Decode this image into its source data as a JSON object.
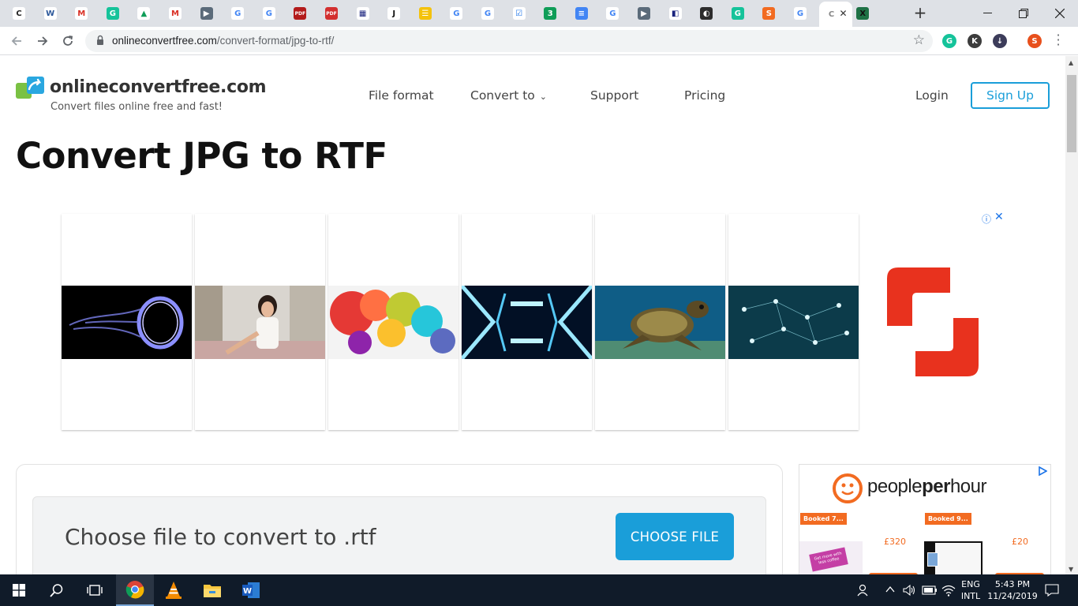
{
  "browser": {
    "tabs": [
      {
        "glyph": "C",
        "color": "#ffffff",
        "fg": "#222",
        "label": "C"
      },
      {
        "glyph": "W",
        "color": "#ffffff",
        "fg": "#2b579a",
        "label": "W"
      },
      {
        "glyph": "M",
        "color": "#ffffff",
        "fg": "#d93025",
        "label": "M"
      },
      {
        "glyph": "G",
        "color": "#15c39a",
        "fg": "#fff",
        "label": "G"
      },
      {
        "glyph": "▲",
        "color": "#ffffff",
        "fg": "#0f9d58",
        "label": "Drive"
      },
      {
        "glyph": "M",
        "color": "#ffffff",
        "fg": "#d93025",
        "label": "M"
      },
      {
        "glyph": "▶",
        "color": "#5b6b7a",
        "fg": "#fff",
        "label": "▶"
      },
      {
        "glyph": "G",
        "color": "#ffffff",
        "fg": "#4285f4",
        "label": "G"
      },
      {
        "glyph": "G",
        "color": "#ffffff",
        "fg": "#4285f4",
        "label": "G"
      },
      {
        "glyph": "PDF",
        "color": "#b31b1b",
        "fg": "#fff",
        "label": "PDF"
      },
      {
        "glyph": "PDF",
        "color": "#d32f2f",
        "fg": "#fff",
        "label": "PDF"
      },
      {
        "glyph": "▦",
        "color": "#ffffff",
        "fg": "#1a237e",
        "label": "▦"
      },
      {
        "glyph": "J",
        "color": "#ffffff",
        "fg": "#111",
        "label": "J"
      },
      {
        "glyph": "☰",
        "color": "#f4c20d",
        "fg": "#fff",
        "label": "☰"
      },
      {
        "glyph": "G",
        "color": "#ffffff",
        "fg": "#4285f4",
        "label": "G"
      },
      {
        "glyph": "G",
        "color": "#ffffff",
        "fg": "#4285f4",
        "label": "G"
      },
      {
        "glyph": "☑",
        "color": "#ffffff",
        "fg": "#1a73e8",
        "label": "☑"
      },
      {
        "glyph": "3",
        "color": "#0f9d58",
        "fg": "#fff",
        "label": "3"
      },
      {
        "glyph": "≡",
        "color": "#4285f4",
        "fg": "#fff",
        "label": "Docs"
      },
      {
        "glyph": "G",
        "color": "#ffffff",
        "fg": "#4285f4",
        "label": "G"
      },
      {
        "glyph": "▶",
        "color": "#5b6b7a",
        "fg": "#fff",
        "label": "▶"
      },
      {
        "glyph": "◧",
        "color": "#ffffff",
        "fg": "#1a237e",
        "label": "◧"
      },
      {
        "glyph": "◐",
        "color": "#2c2c2c",
        "fg": "#fff",
        "label": "◐"
      },
      {
        "glyph": "G",
        "color": "#15c39a",
        "fg": "#fff",
        "label": "G"
      },
      {
        "glyph": "S",
        "color": "#f26b21",
        "fg": "#fff",
        "label": "S"
      },
      {
        "glyph": "G",
        "color": "#ffffff",
        "fg": "#4285f4",
        "label": "G"
      },
      {
        "glyph": "C",
        "color": "#ffffff",
        "fg": "#888",
        "label": "C",
        "active": true
      },
      {
        "glyph": "X",
        "color": "#1e7145",
        "fg": "#111",
        "label": "X"
      }
    ],
    "url_host": "onlineconvertfree.com",
    "url_path": "/convert-format/jpg-to-rtf/",
    "extensions": [
      {
        "glyph": "G",
        "color": "#15c39a"
      },
      {
        "glyph": "K",
        "color": "#3c3c3c"
      },
      {
        "glyph": "↓",
        "color": "#3c3c5a"
      },
      {
        "glyph": "S",
        "color": "#e8501c"
      }
    ]
  },
  "site": {
    "logo_name": "onlineconvertfree.com",
    "logo_tagline": "Convert files online free and fast!",
    "nav": {
      "file_format": "File format",
      "convert_to": "Convert to",
      "support": "Support",
      "pricing": "Pricing"
    },
    "login": "Login",
    "signup": "Sign Up",
    "page_title": "Convert JPG to RTF"
  },
  "ad_strip": {
    "info_icon": "ⓘ",
    "close_icon": "✕"
  },
  "converter": {
    "prompt": "Choose file to convert to .rtf",
    "button": "CHOOSE FILE"
  },
  "side_ad": {
    "brand_a": "people",
    "brand_b": "per",
    "brand_c": "hour",
    "booked_1": "Booked 7...",
    "booked_2": "Booked 9...",
    "price_1": "£320",
    "price_2": "£20",
    "banner_text": "Get more with less coffee"
  },
  "taskbar": {
    "lang_top": "ENG",
    "lang_bottom": "INTL",
    "time": "5:43 PM",
    "date": "11/24/2019"
  },
  "colors": {
    "accent": "#1a9ed9",
    "ad_red": "#e8321e",
    "pph_orange": "#f26b21"
  }
}
